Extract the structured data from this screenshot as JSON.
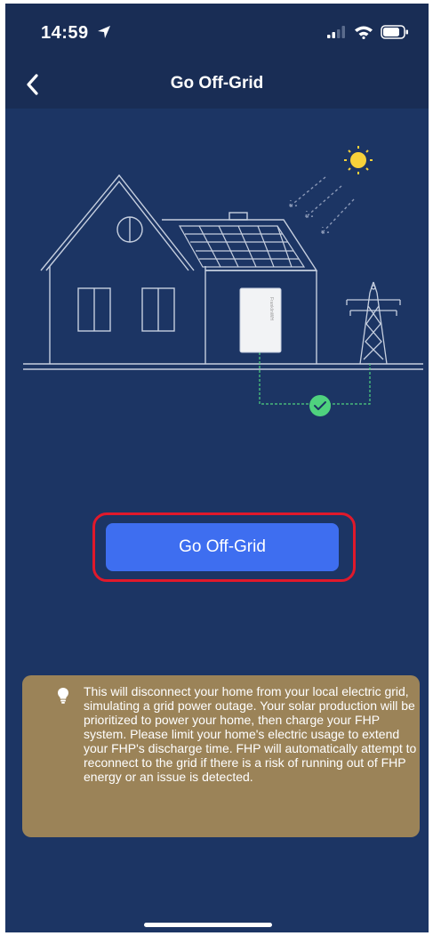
{
  "status_bar": {
    "time": "14:59",
    "icons": [
      "location-arrow-icon",
      "signal-icon",
      "wifi-icon",
      "battery-icon"
    ]
  },
  "header": {
    "title": "Go Off-Grid",
    "back_icon": "chevron-left-icon"
  },
  "illustration": {
    "icons": [
      "sun-icon",
      "house-icon",
      "solar-panel-icon",
      "battery-unit-icon",
      "transmission-tower-icon",
      "check-icon"
    ],
    "battery_label": "FranklinWH"
  },
  "action": {
    "button_label": "Go Off-Grid"
  },
  "notice": {
    "icon": "lightbulb-icon",
    "text": "This will disconnect your home from your local electric grid, simulating a grid power outage. Your solar production will be prioritized to power your home, then charge your FHP system. Please limit your home's electric usage to extend your FHP's discharge time. FHP will automatically attempt to reconnect to the grid if there is a risk of running out of FHP energy or an issue is detected."
  },
  "colors": {
    "background": "#1c3564",
    "header_bg": "#192d55",
    "button": "#3e6ef0",
    "highlight_border": "#e0192b",
    "notice_bg": "#9b8358",
    "check_green": "#4fd27e",
    "sun": "#f7d23a"
  }
}
